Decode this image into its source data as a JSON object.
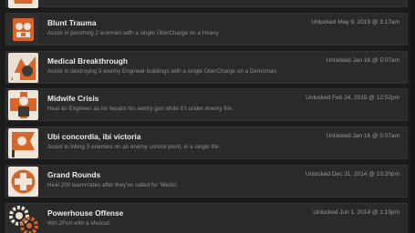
{
  "achievements": [
    {
      "title": "",
      "desc": "",
      "unlocked": "",
      "icon": "medic-saw-icon"
    },
    {
      "title": "Blunt Trauma",
      "desc": "Assist in punching 2 enemies with a single ÜberCharge on a Heavy.",
      "unlocked": "Unlocked May 9, 2019 @ 3:17am",
      "icon": "medic-fists-icon"
    },
    {
      "title": "Medical Breakthrough",
      "desc": "Assist in destroying 5 enemy Engineer buildings with a single ÜberCharge on a Demoman.",
      "unlocked": "Unlocked Jan 16 @ 5:07am",
      "icon": "medic-bomb-icon"
    },
    {
      "title": "Midwife Crisis",
      "desc": "Heal an Engineer as he repairs his sentry gun while it's under enemy fire.",
      "unlocked": "Unlocked Feb 24, 2015 @ 12:52pm",
      "icon": "medic-engineer-icon"
    },
    {
      "title": "Ubi concordia, ibi victoria",
      "desc": "Assist in killing 3 enemies on an enemy control point, in a single life.",
      "unlocked": "Unlocked Jan 16 @ 5:07am",
      "icon": "medic-flag-icon"
    },
    {
      "title": "Grand Rounds",
      "desc": "Heal 200 teammates after they've called for 'Medic'.",
      "unlocked": "Unlocked Dec 31, 2014 @ 10:20pm",
      "icon": "medic-cross-icon"
    },
    {
      "title": "Powerhouse Offense",
      "desc": "Win 2Fort with a shutout.",
      "unlocked": "Unlocked Jun 1, 2014 @ 1:10pm",
      "icon": "gears-icon"
    }
  ],
  "colors": {
    "background": "#1b1b1b",
    "row": "#2a2a2a",
    "title": "#ececec",
    "desc": "#8e8e8e",
    "accent": "#d9652b"
  }
}
